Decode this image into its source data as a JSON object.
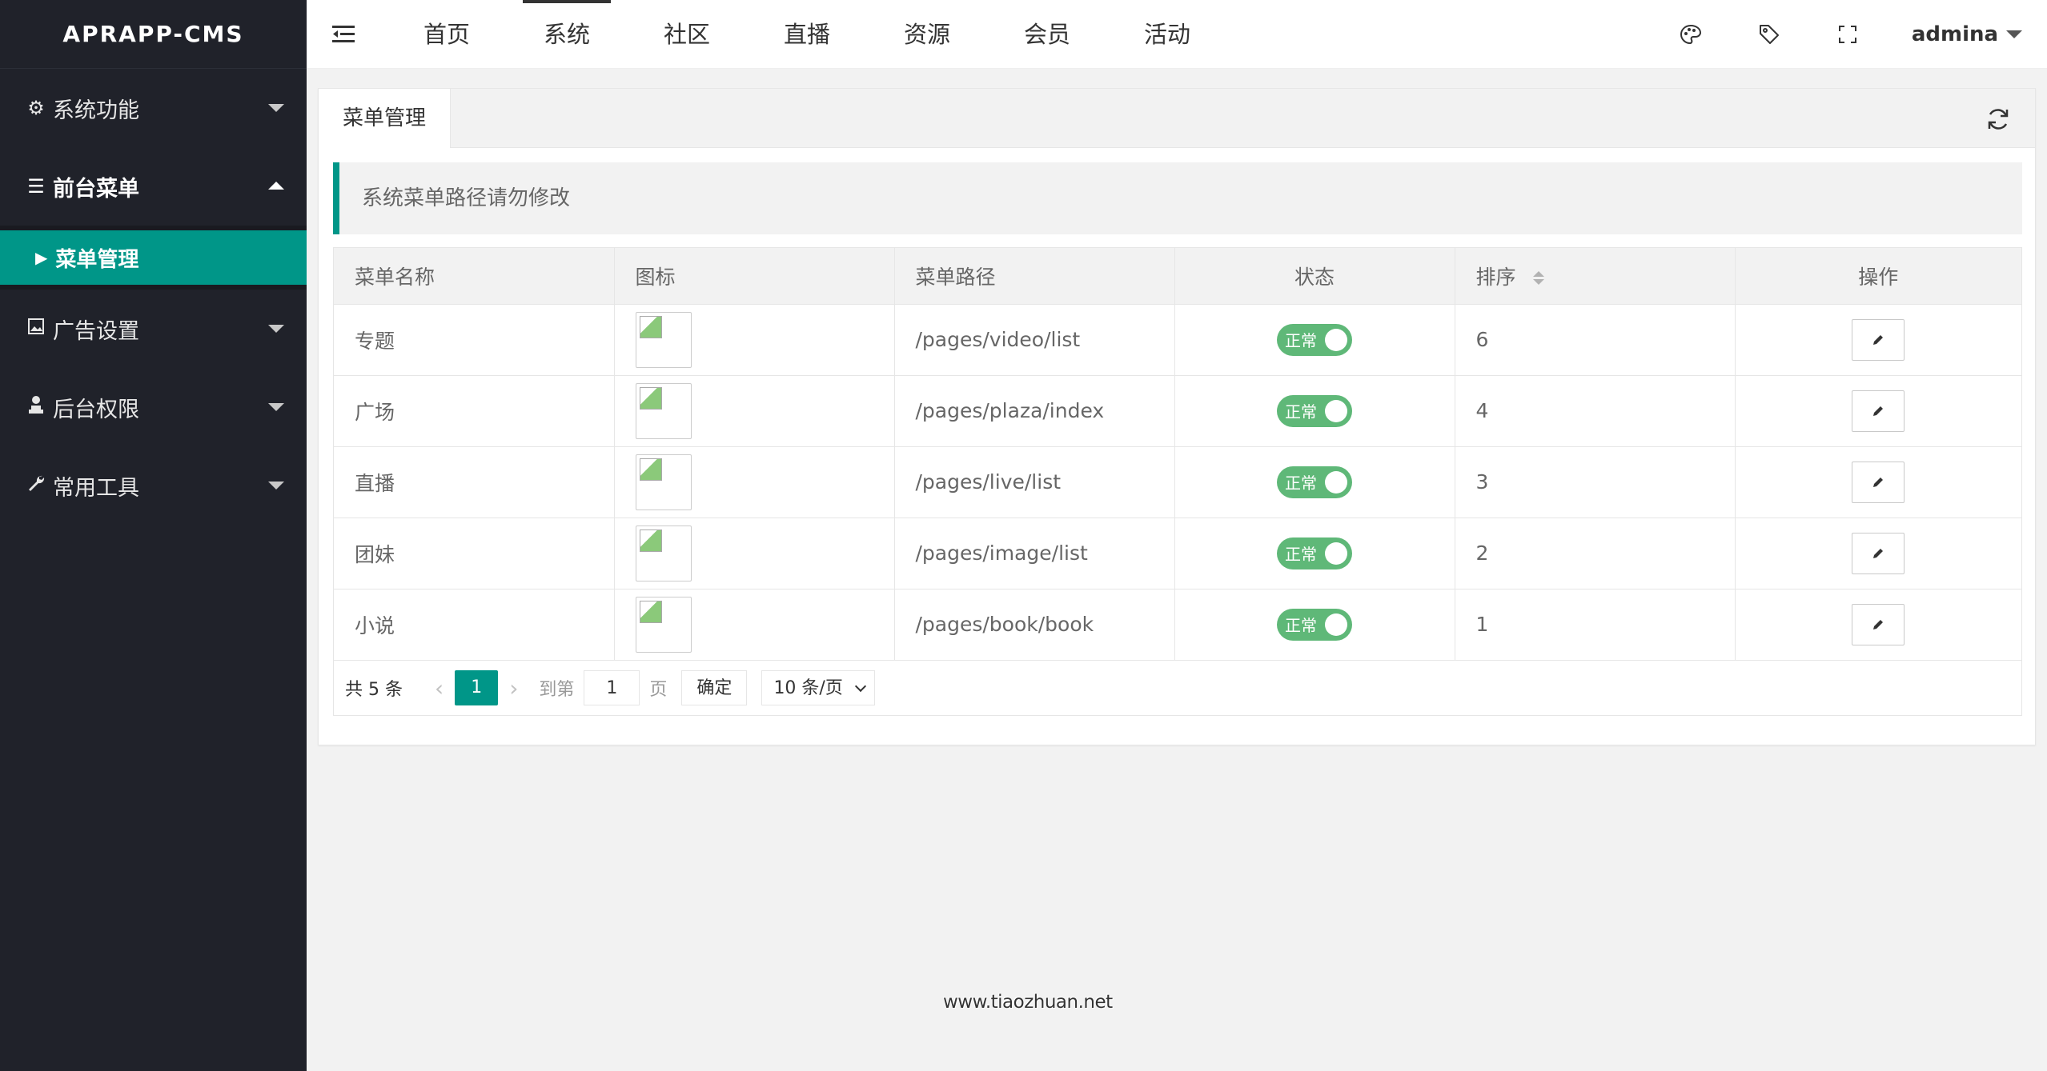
{
  "app": {
    "logo": "APRAPP-CMS"
  },
  "sidebar": {
    "items": [
      {
        "label": "系统功能",
        "icon": "gear-icon",
        "open": false
      },
      {
        "label": "前台菜单",
        "icon": "list-icon",
        "open": true
      },
      {
        "label": "广告设置",
        "icon": "image-icon",
        "open": false
      },
      {
        "label": "后台权限",
        "icon": "user-icon",
        "open": false
      },
      {
        "label": "常用工具",
        "icon": "wrench-icon",
        "open": false
      }
    ],
    "sub_items": [
      {
        "label": "菜单管理",
        "active": true
      }
    ]
  },
  "header": {
    "nav": [
      "首页",
      "系统",
      "社区",
      "直播",
      "资源",
      "会员",
      "活动"
    ],
    "active_nav": "系统",
    "username": "admina",
    "icons": [
      "palette-icon",
      "tag-icon",
      "fullscreen-icon"
    ]
  },
  "tab": {
    "label": "菜单管理"
  },
  "notice": "系统菜单路径请勿修改",
  "table": {
    "headers": [
      "菜单名称",
      "图标",
      "菜单路径",
      "状态",
      "排序",
      "操作"
    ],
    "rows": [
      {
        "name": "专题",
        "path": "/pages/video/list",
        "status": "正常",
        "order": "6"
      },
      {
        "name": "广场",
        "path": "/pages/plaza/index",
        "status": "正常",
        "order": "4"
      },
      {
        "name": "直播",
        "path": "/pages/live/list",
        "status": "正常",
        "order": "3"
      },
      {
        "name": "团妹",
        "path": "/pages/image/list",
        "status": "正常",
        "order": "2"
      },
      {
        "name": "小说",
        "path": "/pages/book/book",
        "status": "正常",
        "order": "1"
      }
    ]
  },
  "pager": {
    "total": "共 5 条",
    "current": "1",
    "goto_label": "到第",
    "page_input": "1",
    "page_unit": "页",
    "confirm": "确定",
    "limit": "10 条/页"
  },
  "watermark": "www.tiaozhuan.net",
  "colors": {
    "sidebar_bg": "#20222a",
    "accent": "#009688",
    "switch_on": "#5fb878"
  }
}
